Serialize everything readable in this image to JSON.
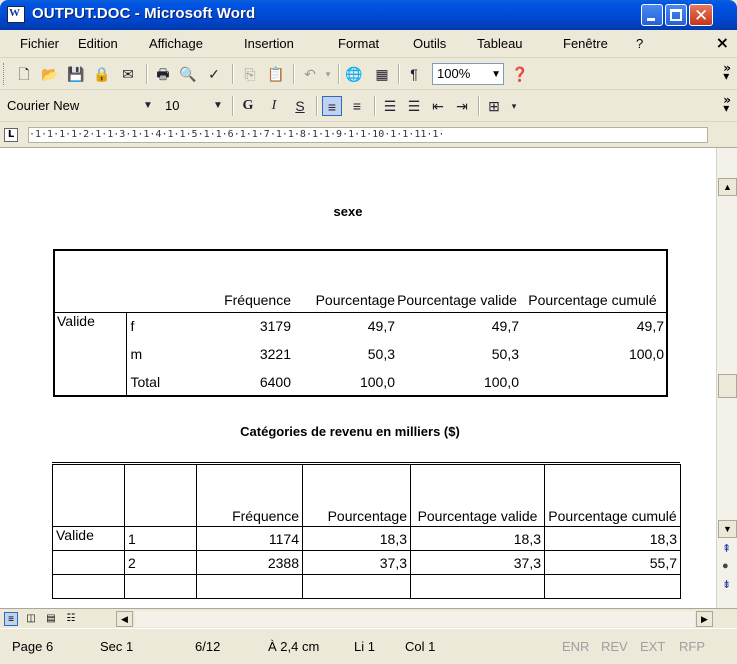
{
  "window": {
    "title": "OUTPUT.DOC - Microsoft Word"
  },
  "menu": [
    "Fichier",
    "Edition",
    "Affichage",
    "Insertion",
    "Format",
    "Outils",
    "Tableau",
    "Fenêtre",
    "?"
  ],
  "toolbar": {
    "zoom": "100%",
    "font": "Courier New",
    "size": "10",
    "bold": "G",
    "italic": "I",
    "underline": "S",
    "pilcrow": "¶"
  },
  "ruler": {
    "ticks": "·1·1·1·1·2·1·1·3·1·1·4·1·1·5·1·1·6·1·1·7·1·1·8·1·1·9·1·1·10·1·1·11·1·"
  },
  "table1": {
    "title": "sexe",
    "headers": [
      "Fréquence",
      "Pourcentage",
      "Pourcentage valide",
      "Pourcentage cumulé"
    ],
    "group": "Valide",
    "rows": [
      {
        "label": "f",
        "freq": "3179",
        "pct": "49,7",
        "valid": "49,7",
        "cum": "49,7"
      },
      {
        "label": "m",
        "freq": "3221",
        "pct": "50,3",
        "valid": "50,3",
        "cum": "100,0"
      },
      {
        "label": "Total",
        "freq": "6400",
        "pct": "100,0",
        "valid": "100,0",
        "cum": ""
      }
    ]
  },
  "table2": {
    "title": "Catégories de revenu en milliers ($)",
    "headers": [
      "Fréquence",
      "Pourcentage",
      "Pourcentage valide",
      "Pourcentage cumulé"
    ],
    "group": "Valide",
    "rows": [
      {
        "label": "1",
        "freq": "1174",
        "pct": "18,3",
        "valid": "18,3",
        "cum": "18,3"
      },
      {
        "label": "2",
        "freq": "2388",
        "pct": "37,3",
        "valid": "37,3",
        "cum": "55,7"
      }
    ]
  },
  "status": {
    "page": "Page 6",
    "sec": "Sec 1",
    "pages": "6/12",
    "at": "À 2,4 cm",
    "line": "Li 1",
    "col": "Col 1",
    "enr": "ENR",
    "rev": "REV",
    "ext": "EXT",
    "rfp": "RFP"
  }
}
